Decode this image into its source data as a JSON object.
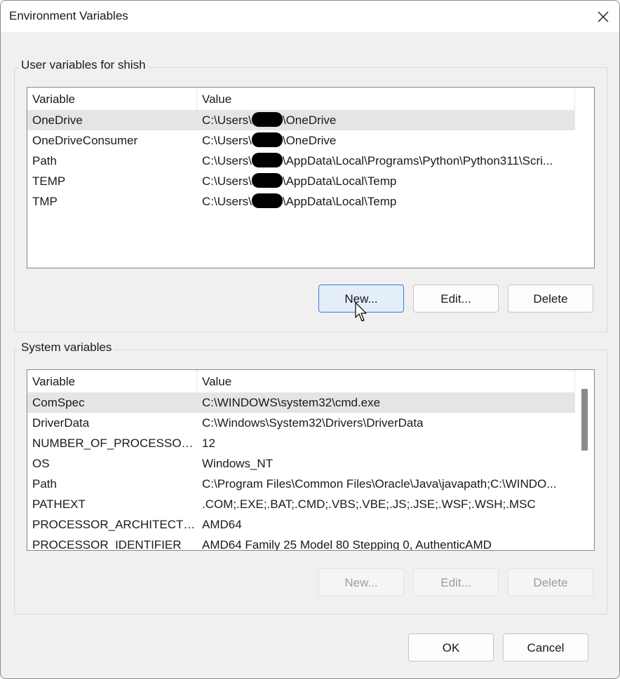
{
  "window": {
    "title": "Environment Variables"
  },
  "user_section": {
    "label": "User variables for shish",
    "columns": [
      "Variable",
      "Value"
    ],
    "rows": [
      {
        "variable": "OneDrive",
        "value_prefix": "C:\\Users\\",
        "value_suffix": "\\OneDrive"
      },
      {
        "variable": "OneDriveConsumer",
        "value_prefix": "C:\\Users\\",
        "value_suffix": "\\OneDrive"
      },
      {
        "variable": "Path",
        "value_prefix": "C:\\Users\\",
        "value_suffix": "\\AppData\\Local\\Programs\\Python\\Python311\\Scri..."
      },
      {
        "variable": "TEMP",
        "value_prefix": "C:\\Users\\",
        "value_suffix": "\\AppData\\Local\\Temp"
      },
      {
        "variable": "TMP",
        "value_prefix": "C:\\Users\\",
        "value_suffix": "\\AppData\\Local\\Temp"
      }
    ],
    "buttons": {
      "new": "New...",
      "edit": "Edit...",
      "delete": "Delete"
    }
  },
  "system_section": {
    "label": "System variables",
    "columns": [
      "Variable",
      "Value"
    ],
    "rows": [
      {
        "variable": "ComSpec",
        "value": "C:\\WINDOWS\\system32\\cmd.exe"
      },
      {
        "variable": "DriverData",
        "value": "C:\\Windows\\System32\\Drivers\\DriverData"
      },
      {
        "variable": "NUMBER_OF_PROCESSORS",
        "value": "12"
      },
      {
        "variable": "OS",
        "value": "Windows_NT"
      },
      {
        "variable": "Path",
        "value": "C:\\Program Files\\Common Files\\Oracle\\Java\\javapath;C:\\WINDO..."
      },
      {
        "variable": "PATHEXT",
        "value": ".COM;.EXE;.BAT;.CMD;.VBS;.VBE;.JS;.JSE;.WSF;.WSH;.MSC"
      },
      {
        "variable": "PROCESSOR_ARCHITECTURE",
        "value": "AMD64"
      },
      {
        "variable": "PROCESSOR_IDENTIFIER",
        "value": "AMD64 Family 25 Model 80 Stepping 0, AuthenticAMD"
      }
    ],
    "buttons": {
      "new": "New...",
      "edit": "Edit...",
      "delete": "Delete"
    }
  },
  "footer": {
    "ok": "OK",
    "cancel": "Cancel"
  },
  "icons": {
    "close": "close-icon",
    "cursor": "mouse-pointer-icon",
    "redaction": "redaction-mark"
  }
}
